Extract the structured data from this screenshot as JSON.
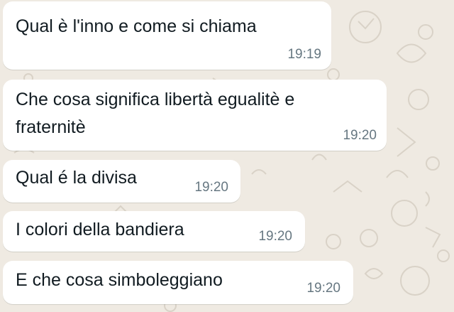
{
  "chat": {
    "background_color": "#efeae2",
    "bubble_color": "#ffffff",
    "text_color": "#111b21",
    "time_color": "#667781",
    "messages": [
      {
        "lines": [
          "Qual è l'inno e come si chiama"
        ],
        "time": "19:19"
      },
      {
        "lines": [
          "Che cosa significa libertà egualitè e",
          "fraternitè"
        ],
        "time": "19:20"
      },
      {
        "lines": [
          "Qual é la divisa"
        ],
        "time": "19:20"
      },
      {
        "lines": [
          "I colori della bandiera"
        ],
        "time": "19:20"
      },
      {
        "lines": [
          "E che cosa simboleggiano"
        ],
        "time": "19:20"
      }
    ]
  }
}
